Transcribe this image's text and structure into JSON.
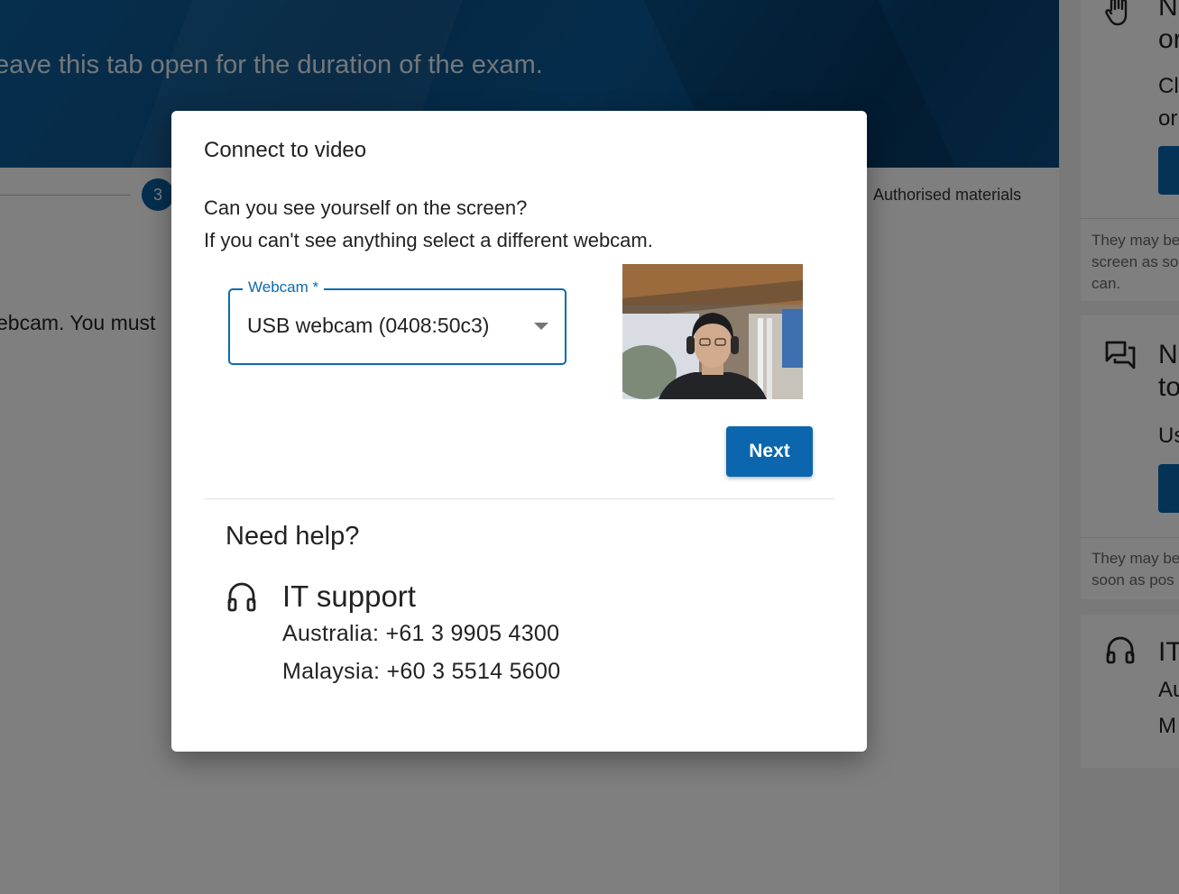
{
  "background": {
    "banner_text": "eave this tab open for the duration of the exam.",
    "stepper": {
      "step_number": "3",
      "step_label": "Authorised materials"
    },
    "body_text": "ebcam. You must",
    "sidebar": {
      "card1": {
        "title_lines": [
          "N",
          "or"
        ],
        "text_lines": [
          "Cl",
          "or"
        ],
        "note": "They may be screen as so can."
      },
      "card2": {
        "title_lines": [
          "N",
          "to"
        ],
        "text_lines": [
          "Us"
        ],
        "note": "They may be soon as pos"
      },
      "card3": {
        "title_lines": [
          "IT"
        ],
        "text_lines": [
          "Au",
          "M"
        ]
      }
    }
  },
  "dialog": {
    "title": "Connect to video",
    "prompt_line1": "Can you see yourself on the screen?",
    "prompt_line2": "If you can't see anything select a different webcam.",
    "webcam_select": {
      "label": "Webcam *",
      "value": "USB webcam (0408:50c3)"
    },
    "next_label": "Next",
    "help": {
      "heading": "Need help?",
      "it_title": "IT support",
      "phone_australia": "Australia: +61 3 9905 4300",
      "phone_malaysia": "Malaysia: +60 3 5514 5600"
    }
  },
  "icons": {
    "hand": "hand-icon",
    "chat": "chat-icon",
    "headset": "headset-icon",
    "dropdown": "chevron-down-icon"
  },
  "colors": {
    "primary": "#0b66ad",
    "banner": "#0a4f86",
    "overlay": "rgba(0,0,0,0.5)"
  }
}
